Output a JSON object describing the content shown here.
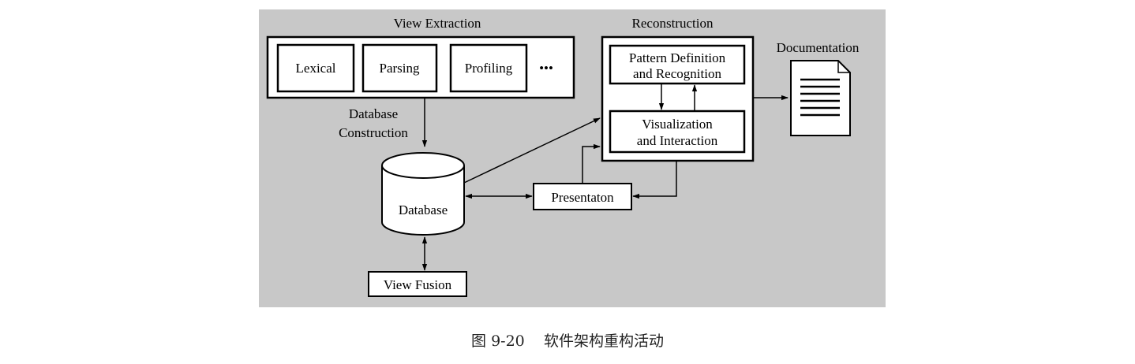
{
  "view_extraction": {
    "title": "View Extraction",
    "steps": [
      "Lexical",
      "Parsing",
      "Profiling"
    ],
    "more": "•••"
  },
  "database_construction": [
    "Database",
    "Construction"
  ],
  "database": "Database",
  "view_fusion": "View Fusion",
  "reconstruction": {
    "title": "Reconstruction",
    "pattern": [
      "Pattern Definition",
      "and Recognition"
    ],
    "visualization": [
      "Visualization",
      "and Interaction"
    ]
  },
  "presentation": "Presentaton",
  "documentation": "Documentation",
  "caption": {
    "number": "图 9-20",
    "text": "软件架构重构活动"
  }
}
